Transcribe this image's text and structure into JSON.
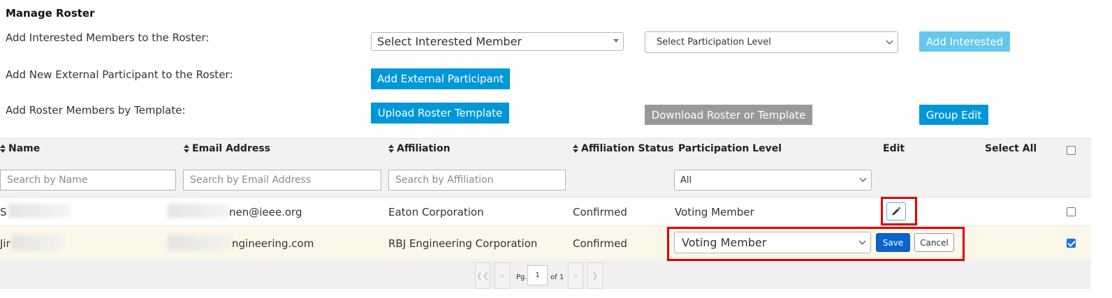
{
  "header": {
    "title": "Manage Roster"
  },
  "add_interested": {
    "label": "Add Interested Members to the Roster:",
    "member_select_value": "Select Interested Member",
    "level_select_value": "Select Participation Level",
    "button": "Add Interested"
  },
  "add_external": {
    "label": "Add New External Participant to the Roster:",
    "button": "Add External Participant"
  },
  "add_template": {
    "label": "Add Roster Members by Template:",
    "upload_button": "Upload Roster Template",
    "download_button": "Download Roster or Template",
    "group_edit_button": "Group Edit"
  },
  "table": {
    "columns": {
      "name": "Name",
      "email": "Email Address",
      "affiliation": "Affiliation",
      "affiliation_status": "Affiliation Status",
      "participation_level": "Participation Level",
      "edit": "Edit",
      "select_all": "Select All"
    },
    "filters": {
      "name_placeholder": "Search by Name",
      "email_placeholder": "Search by Email Address",
      "affiliation_placeholder": "Search by Affiliation",
      "level_value": "All"
    },
    "rows": [
      {
        "name": "S",
        "email": "nen@ieee.org",
        "affiliation": "Eaton Corporation",
        "status": "Confirmed",
        "level": "Voting Member",
        "selected": false
      },
      {
        "name": "Jir",
        "email": "ngineering.com",
        "affiliation": "RBJ Engineering Corporation",
        "status": "Confirmed",
        "level_select_value": "Voting Member",
        "save_label": "Save",
        "cancel_label": "Cancel",
        "selected": true
      }
    ]
  },
  "pager": {
    "page_label": "Pg.",
    "page_value": "1",
    "of_label": "of 1"
  },
  "colors": {
    "primary_button": "#0097d8",
    "disabled_button": "#66c7ec",
    "gray_button": "#999999",
    "highlight_box": "#e00000",
    "editing_row": "#fbf8e9"
  }
}
